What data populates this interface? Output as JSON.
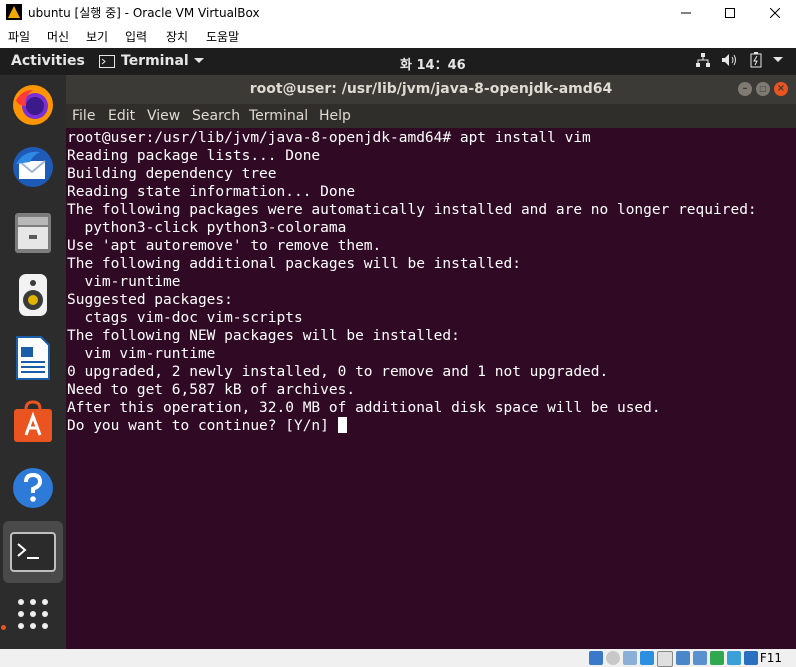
{
  "host_window": {
    "title": "ubuntu [실행 중] - Oracle VM VirtualBox",
    "menu": [
      "파일",
      "머신",
      "보기",
      "입력",
      "장치",
      "도움말"
    ],
    "controls": [
      "minimize-icon",
      "maximize-icon",
      "close-icon"
    ]
  },
  "topbar": {
    "activities": "Activities",
    "app_label": "Terminal",
    "clock": "화 14：46",
    "tray_icons": [
      "network-icon",
      "volume-icon",
      "battery-icon",
      "power-menu-icon"
    ]
  },
  "dock": {
    "items": [
      "firefox-icon",
      "thunderbird-icon",
      "files-icon",
      "rhythmbox-icon",
      "writer-icon",
      "software-icon",
      "help-icon",
      "terminal-icon",
      "apps-grid-icon"
    ],
    "active": "terminal-icon",
    "accent_color": "#e95420"
  },
  "terminal": {
    "title": "root@user: /usr/lib/jvm/java-8-openjdk-amd64",
    "menu": [
      "File",
      "Edit",
      "View",
      "Search",
      "Terminal",
      "Help"
    ],
    "lines": [
      "root@user:/usr/lib/jvm/java-8-openjdk-amd64# apt install vim",
      "Reading package lists... Done",
      "Building dependency tree",
      "Reading state information... Done",
      "The following packages were automatically installed and are no longer required:",
      "  python3-click python3-colorama",
      "Use 'apt autoremove' to remove them.",
      "The following additional packages will be installed:",
      "  vim-runtime",
      "Suggested packages:",
      "  ctags vim-doc vim-scripts",
      "The following NEW packages will be installed:",
      "  vim vim-runtime",
      "0 upgraded, 2 newly installed, 0 to remove and 1 not upgraded.",
      "Need to get 6,587 kB of archives.",
      "After this operation, 32.0 MB of additional disk space will be used."
    ],
    "prompt": "Do you want to continue? [Y/n] ",
    "background_color": "#300a24"
  },
  "vbox_status": {
    "icons": [
      "hdd-icon",
      "optical-icon",
      "audio-icon",
      "network-icon",
      "usb-icon",
      "shared-folder-icon",
      "display-icon",
      "recording-icon",
      "mouse-integration-icon",
      "keyboard-capture-icon"
    ],
    "host_key": "F11"
  }
}
